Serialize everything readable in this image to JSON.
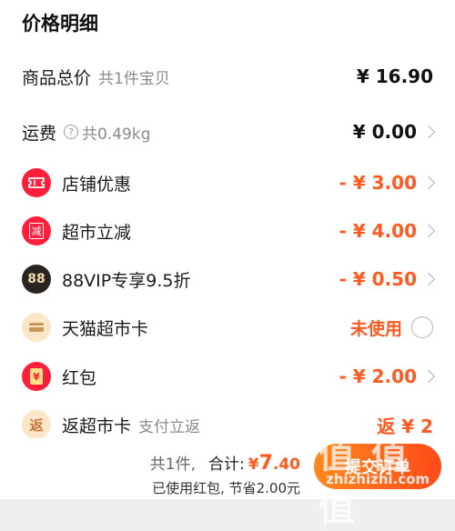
{
  "section_title": "价格明细",
  "rows": {
    "goods": {
      "label": "商品总价",
      "sub": "共1件宝贝",
      "value": "¥ 16.90"
    },
    "shipping": {
      "label": "运费",
      "sub": "共0.49kg",
      "value": "¥ 0.00"
    },
    "store_discount": {
      "label": "店铺优惠",
      "value": "- ¥ 3.00",
      "icon": "ticket-icon"
    },
    "market_reduce": {
      "label": "超市立减",
      "value": "- ¥ 4.00",
      "icon": "reduce-icon",
      "icon_text": "减"
    },
    "vip": {
      "label": "88VIP专享9.5折",
      "value": "- ¥ 0.50",
      "icon": "88vip-icon",
      "icon_text": "88"
    },
    "tmall_card": {
      "label": "天猫超市卡",
      "value": "未使用",
      "icon": "card-icon"
    },
    "red_packet": {
      "label": "红包",
      "value": "- ¥ 2.00",
      "icon": "red-packet-icon",
      "icon_text": "¥"
    },
    "cashback": {
      "label": "返超市卡",
      "sub": "支付立返",
      "value": "返 ¥ 2",
      "icon": "cashback-icon",
      "icon_text": "返"
    }
  },
  "footer": {
    "count": "共1件,",
    "total_label": "合计:",
    "currency": "¥",
    "total_int": "7",
    "total_dec": ".40",
    "saved": "已使用红包, 节省2.00元",
    "submit": "提交订单",
    "watermark": "值 值 值",
    "watermark_url": "zhizhizhi.com"
  },
  "colors": {
    "accent": "#ff5a1f",
    "red": "#ff1f3a",
    "dark": "#2a2420",
    "beige": "#fbe7c8"
  }
}
